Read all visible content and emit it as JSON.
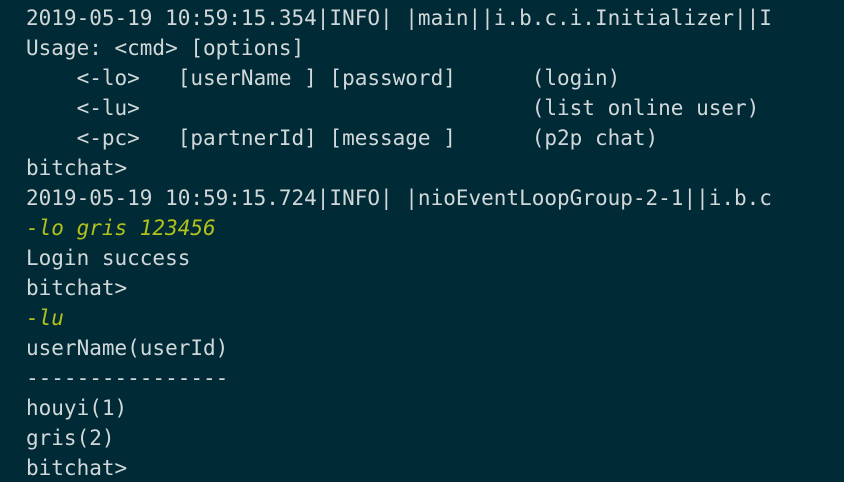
{
  "terminal": {
    "colors": {
      "background": "#002b36",
      "output_text": "#d2d8d9",
      "user_input": "#b2c21a"
    },
    "lines": [
      {
        "text": "2019-05-19 10:59:15.354|INFO| |main||i.b.c.i.Initializer||I",
        "kind": "log"
      },
      {
        "text": "Usage: <cmd> [options]",
        "kind": "output"
      },
      {
        "text": "    <-lo>   [userName ] [password]      (login)",
        "kind": "output"
      },
      {
        "text": "    <-lu>                               (list online user)",
        "kind": "output"
      },
      {
        "text": "    <-pc>   [partnerId] [message ]      (p2p chat)",
        "kind": "output"
      },
      {
        "text": "bitchat>",
        "kind": "prompt"
      },
      {
        "text": "2019-05-19 10:59:15.724|INFO| |nioEventLoopGroup-2-1||i.b.c",
        "kind": "log"
      },
      {
        "text": "-lo gris 123456",
        "kind": "input"
      },
      {
        "text": "Login success",
        "kind": "output"
      },
      {
        "text": "bitchat>",
        "kind": "prompt"
      },
      {
        "text": "-lu",
        "kind": "input"
      },
      {
        "text": "userName(userId)",
        "kind": "output"
      },
      {
        "text": "----------------",
        "kind": "output"
      },
      {
        "text": "houyi(1)",
        "kind": "output"
      },
      {
        "text": "gris(2)",
        "kind": "output"
      },
      {
        "text": "bitchat>",
        "kind": "prompt"
      }
    ]
  }
}
